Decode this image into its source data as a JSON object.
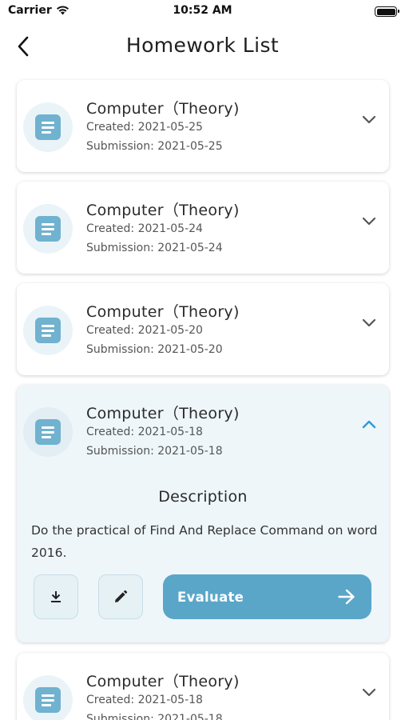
{
  "status_bar": {
    "carrier": "Carrier",
    "time": "10:52 AM"
  },
  "header": {
    "title": "Homework List",
    "back_icon": "chevron-left-icon"
  },
  "colors": {
    "accent": "#5aa6c9",
    "icon_blue": "#70b2cf",
    "chevron_active": "#2e9ad6",
    "expanded_bg": "#eef6fa"
  },
  "homework": [
    {
      "title": "Computer（Theory)",
      "created": "Created: 2021-05-25",
      "submission": "Submission: 2021-05-25",
      "expanded": false
    },
    {
      "title": "Computer（Theory)",
      "created": "Created: 2021-05-24",
      "submission": "Submission: 2021-05-24",
      "expanded": false
    },
    {
      "title": "Computer（Theory)",
      "created": "Created: 2021-05-20",
      "submission": "Submission: 2021-05-20",
      "expanded": false
    },
    {
      "title": "Computer（Theory)",
      "created": "Created: 2021-05-18",
      "submission": "Submission: 2021-05-18",
      "expanded": true,
      "description_heading": "Description",
      "description": "Do the practical of Find And Replace Command on word 2016.",
      "evaluate_label": "Evaluate",
      "actions": [
        "download-icon",
        "edit-pencil-icon",
        "arrow-right-icon"
      ]
    },
    {
      "title": "Computer（Theory)",
      "created": "Created: 2021-05-18",
      "submission": "Submission: 2021-05-18",
      "expanded": false
    }
  ]
}
